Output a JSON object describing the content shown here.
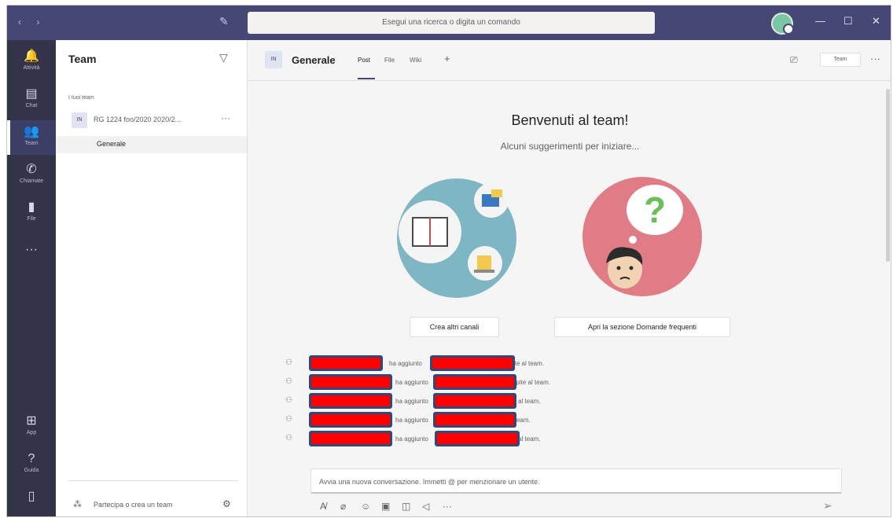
{
  "titlebar": {
    "search_placeholder": "Esegui una ricerca o digita un comando",
    "nav_back": "‹",
    "nav_forward": "›",
    "compose_icon": "compose-icon",
    "minimize": "—",
    "maximize": "☐",
    "close": "✕"
  },
  "appbar": {
    "items": [
      {
        "icon": "bell-icon",
        "glyph": "🔔",
        "label": "Attività"
      },
      {
        "icon": "chat-icon",
        "glyph": "▤",
        "label": "Chat"
      },
      {
        "icon": "teams-icon",
        "glyph": "👥",
        "label": "Team"
      },
      {
        "icon": "phone-icon",
        "glyph": "✆",
        "label": "Chiamate"
      },
      {
        "icon": "file-icon",
        "glyph": "▮",
        "label": "File"
      }
    ],
    "more": "···",
    "bottom": [
      {
        "icon": "apps-icon",
        "glyph": "⊞",
        "label": "App"
      },
      {
        "icon": "help-icon",
        "glyph": "?",
        "label": "Guida"
      },
      {
        "icon": "device-icon",
        "glyph": "▯",
        "label": ""
      }
    ]
  },
  "teampanel": {
    "title": "Team",
    "section": "I tuoi team",
    "team": {
      "badge": "IN",
      "name": "RG 1224 foo/2020 2020/2...",
      "more": "···"
    },
    "channel": "Generale",
    "join": "Partecipa o crea un team"
  },
  "channel": {
    "badge": "IN",
    "title": "Generale",
    "tabs": [
      "Post",
      "File",
      "Wiki"
    ],
    "add_tab": "+",
    "team_button": "Team",
    "more": "···"
  },
  "welcome": {
    "title": "Benvenuti al team!",
    "subtitle": "Alcuni suggerimenti per iniziare...",
    "button_channels": "Crea altri canali",
    "button_faq": "Apri la sezione Domande frequenti"
  },
  "activity": [
    {
      "middle": "ha aggiunto",
      "tail": "Ospites come ospite al team."
    },
    {
      "middle": "ha aggiunto",
      "tail": "Ospites come ospite al team."
    },
    {
      "middle": "ha aggiunto",
      "tail": "nel come ospite al team."
    },
    {
      "middle": "ha aggiunto",
      "tail": "come ospite al team."
    },
    {
      "middle": "ha aggiunto",
      "tail": "nel come ospite al team."
    }
  ],
  "compose": {
    "placeholder": "Avvia una nuova conversazione. Immetti @ per menzionare un utente."
  },
  "colors": {
    "titlebar": "#464775",
    "appbar": "#33344a",
    "accent": "#6264a7",
    "redaction": "#ff0000"
  }
}
